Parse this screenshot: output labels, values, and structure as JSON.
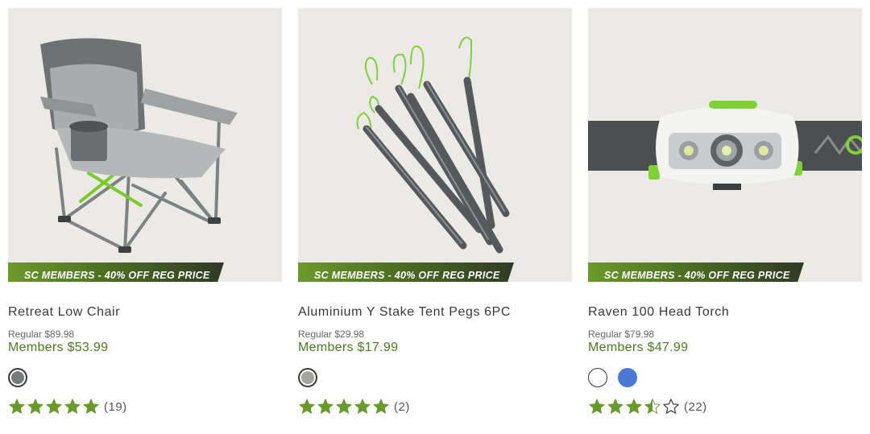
{
  "products": [
    {
      "badge": "SC MEMBERS - 40% OFF REG PRICE",
      "name": "Retreat Low Chair",
      "regular": "Regular $89.98",
      "members": "Members $53.99",
      "swatches": [
        {
          "color": "#777b7c",
          "selected": true
        }
      ],
      "rating": 5,
      "review_count": "(19)",
      "image_icon": "camping-chair"
    },
    {
      "badge": "SC MEMBERS - 40% OFF REG PRICE",
      "name": "Aluminium Y Stake Tent Pegs 6PC",
      "regular": "Regular $29.98",
      "members": "Members $17.99",
      "swatches": [
        {
          "color": "#a3a3a0",
          "selected": true
        }
      ],
      "rating": 5,
      "review_count": "(2)",
      "image_icon": "tent-pegs"
    },
    {
      "badge": "SC MEMBERS - 40% OFF REG PRICE",
      "name": "Raven 100 Head Torch",
      "regular": "Regular $79.98",
      "members": "Members $47.99",
      "swatches": [
        {
          "color": "#ffffff",
          "selected": false
        },
        {
          "color": "#4a78d4",
          "selected": false
        }
      ],
      "rating": 3.5,
      "review_count": "(22)",
      "image_icon": "head-torch"
    }
  ],
  "colors": {
    "accent": "#6a9a2c",
    "members_price": "#4e7a1f",
    "star": "#6a9a2c",
    "image_bg": "#eceae6"
  }
}
